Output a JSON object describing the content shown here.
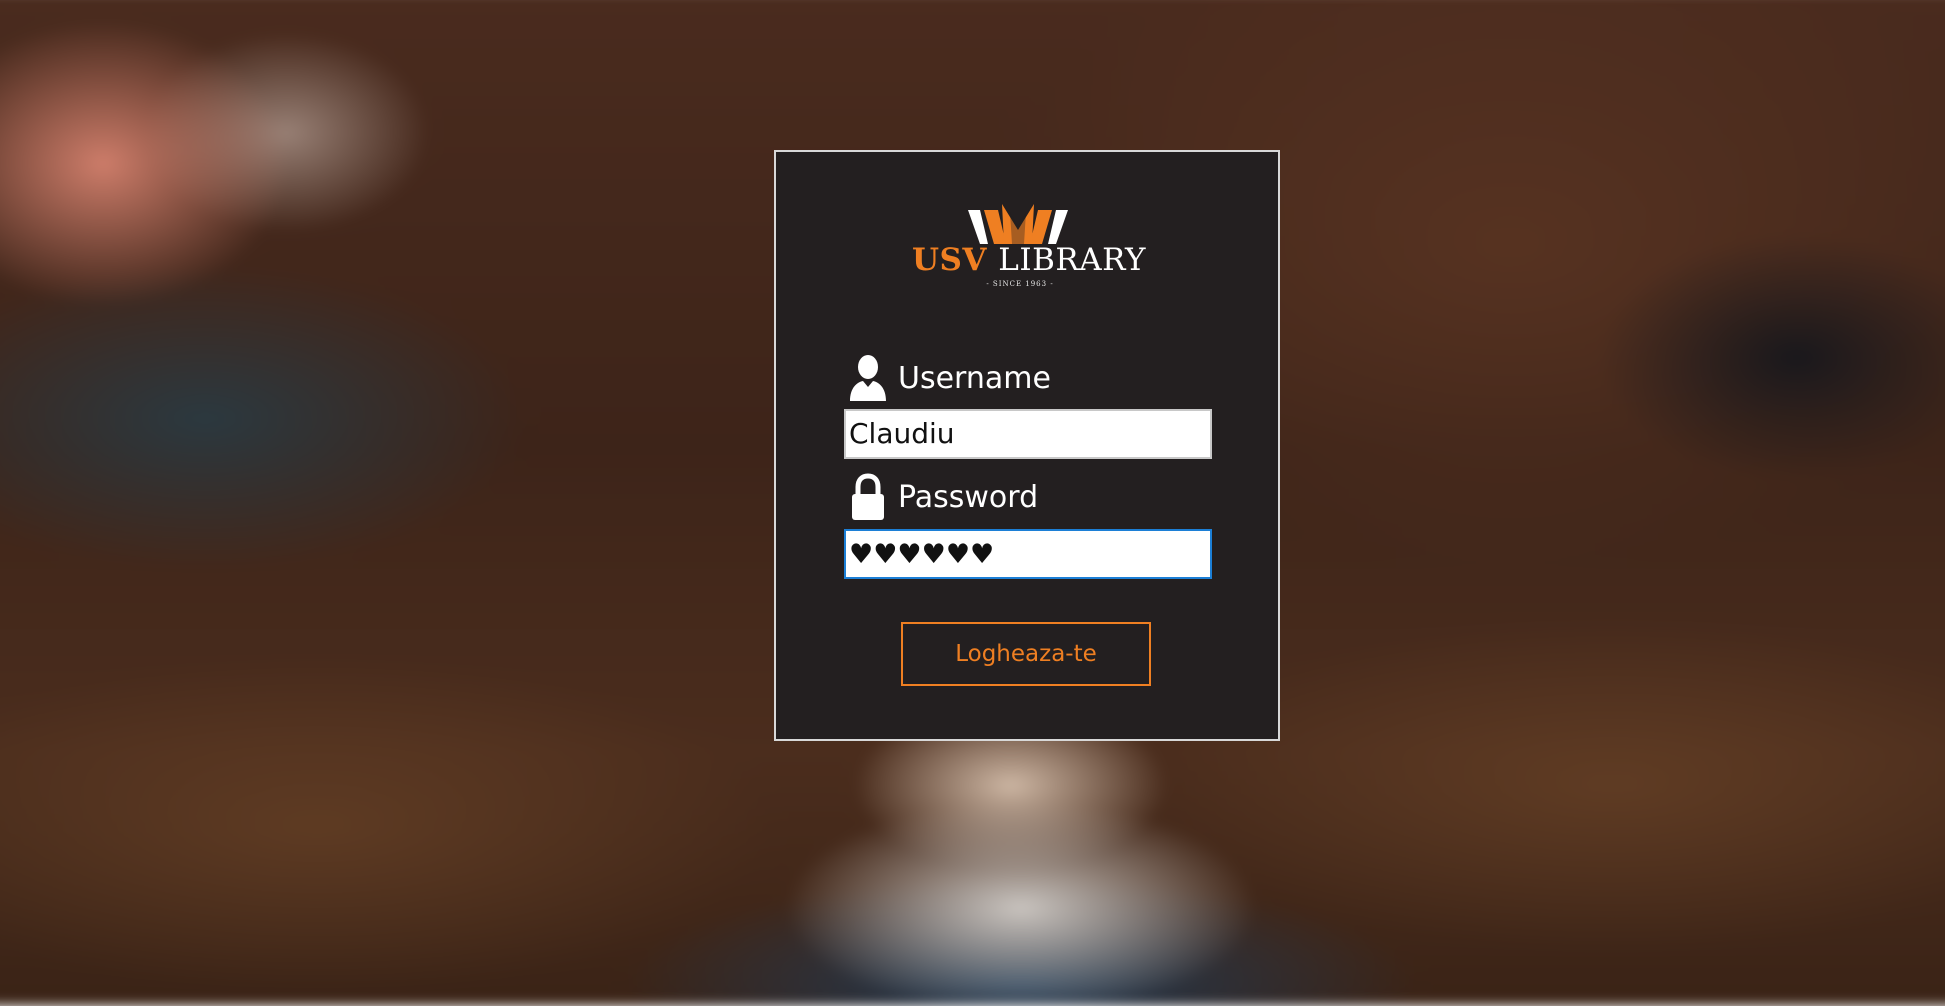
{
  "background": {
    "description_icon": "blurred-reading-photo"
  },
  "logo": {
    "usv_text": "USV",
    "library_text": "LIBRARY",
    "since_text": "- SINCE 1963 -",
    "accent_color": "#ef7f22"
  },
  "form": {
    "username": {
      "icon": "user-icon",
      "label": "Username",
      "value": "Claudiu"
    },
    "password": {
      "icon": "lock-icon",
      "label": "Password",
      "masked_value": "♥♥♥♥♥♥"
    },
    "login_button_label": "Logheaza-te"
  },
  "colors": {
    "panel_bg": "#231f20",
    "panel_border": "#d8d8d8",
    "accent": "#ef7f22",
    "focus_border": "#1c7fd6"
  }
}
